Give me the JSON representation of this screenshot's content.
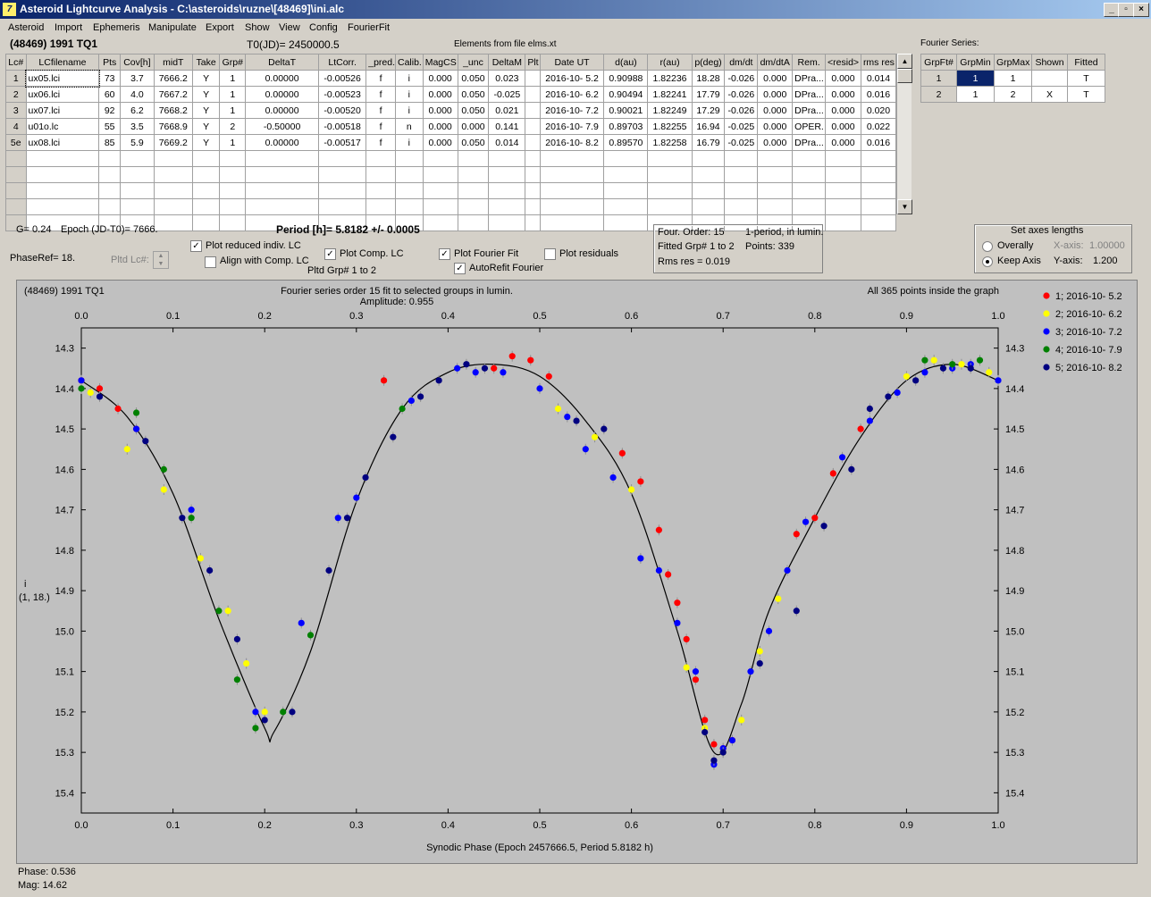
{
  "window": {
    "title": "Asteroid Lightcurve Analysis - C:\\asteroids\\ruzne\\[48469]\\ini.alc",
    "icon_glyph": "7"
  },
  "menu": [
    "Asteroid",
    "Import",
    "Ephemeris",
    "Manipulate",
    "Export",
    "Show",
    "View",
    "Config",
    "FourierFit"
  ],
  "header": {
    "asteroid": "(48469) 1991 TQ1",
    "t0": "T0(JD)= 2450000.5",
    "elements": "Elements from file elms.xt"
  },
  "lc_table": {
    "columns": [
      "Lc#",
      "LCfilename",
      "Pts",
      "Cov[h]",
      "midT",
      "Take",
      "Grp#",
      "DeltaT",
      "LtCorr.",
      "_pred.",
      "Calib.",
      "MagCS",
      "_unc",
      "DeltaM",
      "Plt",
      "Date UT",
      "d(au)",
      "r(au)",
      "p(deg)",
      "dm/dt",
      "dm/dtA",
      "Rem.",
      "<resid>",
      "rms res"
    ],
    "rows": [
      [
        "1",
        "ux05.lci",
        "73",
        "3.7",
        "7666.2",
        "Y",
        "1",
        "0.00000",
        "-0.00526",
        "f",
        "i",
        "0.000",
        "0.050",
        "0.023",
        "",
        "2016-10- 5.2",
        "0.90988",
        "1.82236",
        "18.28",
        "-0.026",
        "0.000",
        "DPra...",
        "0.000",
        "0.014"
      ],
      [
        "2",
        "ux06.lci",
        "60",
        "4.0",
        "7667.2",
        "Y",
        "1",
        "0.00000",
        "-0.00523",
        "f",
        "i",
        "0.000",
        "0.050",
        "-0.025",
        "",
        "2016-10- 6.2",
        "0.90494",
        "1.82241",
        "17.79",
        "-0.026",
        "0.000",
        "DPra...",
        "0.000",
        "0.016"
      ],
      [
        "3",
        "ux07.lci",
        "92",
        "6.2",
        "7668.2",
        "Y",
        "1",
        "0.00000",
        "-0.00520",
        "f",
        "i",
        "0.000",
        "0.050",
        "0.021",
        "",
        "2016-10- 7.2",
        "0.90021",
        "1.82249",
        "17.29",
        "-0.026",
        "0.000",
        "DPra...",
        "0.000",
        "0.020"
      ],
      [
        "4",
        "u01o.lc",
        "55",
        "3.5",
        "7668.9",
        "Y",
        "2",
        "-0.50000",
        "-0.00518",
        "f",
        "n",
        "0.000",
        "0.000",
        "0.141",
        "",
        "2016-10- 7.9",
        "0.89703",
        "1.82255",
        "16.94",
        "-0.025",
        "0.000",
        "OPER.",
        "0.000",
        "0.022"
      ],
      [
        "5e",
        "ux08.lci",
        "85",
        "5.9",
        "7669.2",
        "Y",
        "1",
        "0.00000",
        "-0.00517",
        "f",
        "i",
        "0.000",
        "0.050",
        "0.014",
        "",
        "2016-10- 8.2",
        "0.89570",
        "1.82258",
        "16.79",
        "-0.025",
        "0.000",
        "DPra...",
        "0.000",
        "0.016"
      ]
    ],
    "empty_rows": 5
  },
  "fourier_table": {
    "title": "Fourier Series:",
    "columns": [
      "GrpFt#",
      "GrpMin",
      "GrpMax",
      "Shown",
      "Fitted"
    ],
    "rows": [
      [
        "1",
        "1",
        "1",
        "",
        "T"
      ],
      [
        "2",
        "1",
        "2",
        "X",
        "T"
      ]
    ]
  },
  "controls": {
    "g": "G= 0.24",
    "epoch": "Epoch (JD-T0)= 7666.",
    "period": "Period [h]= 5.8182 +/- 0.0005",
    "phaseref": "PhaseRef= 18.",
    "pltd_lc": "Pltd Lc#:",
    "plot_reduced": "Plot reduced indiv. LC",
    "align_comp": "Align with Comp. LC",
    "plot_comp": "Plot Comp. LC",
    "pltd_grp": "Pltd Grp#  1   to   2",
    "plot_fourier": "Plot Fourier Fit",
    "autorefit": "AutoRefit Fourier",
    "plot_resid": "Plot residuals",
    "check_reduced": true,
    "check_align": false,
    "check_comp": true,
    "check_fourier": true,
    "check_autorefit": true,
    "check_resid": false
  },
  "info_box": {
    "order": "Four. Order: 15",
    "period_mode": "1-period, in lumin.",
    "fitted": "Fitted Grp# 1 to 2",
    "points": "Points: 339",
    "rms": "Rms res     = 0.019"
  },
  "axes_box": {
    "title": "Set axes lengths",
    "overally": "Overally",
    "keep_axis": "Keep Axis",
    "x_axis_label": "X-axis:",
    "x_axis_value": "1.00000",
    "y_axis_label": "Y-axis:",
    "y_axis_value": "1.200",
    "selected": "keep_axis"
  },
  "plot": {
    "asteroid": "(48469) 1991 TQ1",
    "header_center": "Fourier series order 15 fit to selected groups in lumin.",
    "amplitude": "Amplitude: 0.955",
    "header_right": "All 365 points inside the graph",
    "ylabel_line1": "i",
    "ylabel_line2": "(1, 18.)",
    "xlabel": "Synodic Phase (Epoch 2457666.5, Period 5.8182 h)"
  },
  "chart_data": {
    "type": "scatter",
    "xlim": [
      0.0,
      1.0
    ],
    "ylim": [
      15.45,
      14.25
    ],
    "x_ticks": [
      "0.0",
      "0.1",
      "0.2",
      "0.3",
      "0.4",
      "0.5",
      "0.6",
      "0.7",
      "0.8",
      "0.9",
      "1.0"
    ],
    "y_ticks": [
      "14.3",
      "14.4",
      "14.5",
      "14.6",
      "14.7",
      "14.8",
      "14.9",
      "15.0",
      "15.1",
      "15.2",
      "15.3",
      "15.4"
    ],
    "y_reversed": true,
    "grid": false,
    "fit_curve": {
      "color": "#000000",
      "x": [
        0.0,
        0.05,
        0.1,
        0.15,
        0.2,
        0.21,
        0.25,
        0.3,
        0.35,
        0.4,
        0.45,
        0.5,
        0.55,
        0.6,
        0.65,
        0.69,
        0.72,
        0.75,
        0.8,
        0.85,
        0.9,
        0.95,
        1.0
      ],
      "y": [
        14.38,
        14.47,
        14.66,
        14.97,
        15.24,
        15.25,
        15.05,
        14.68,
        14.45,
        14.36,
        14.34,
        14.37,
        14.48,
        14.66,
        15.0,
        15.3,
        15.18,
        14.95,
        14.72,
        14.52,
        14.38,
        14.34,
        14.38
      ]
    },
    "legend_position": "top-right",
    "series": [
      {
        "name": "1; 2016-10- 5.2",
        "color": "#ff0000",
        "x": [
          0.0,
          0.02,
          0.04,
          0.06,
          0.33,
          0.45,
          0.47,
          0.49,
          0.51,
          0.59,
          0.61,
          0.63,
          0.64,
          0.65,
          0.66,
          0.67,
          0.68,
          0.69,
          0.7,
          0.71,
          0.78,
          0.8,
          0.82,
          0.85
        ],
        "y": [
          14.38,
          14.4,
          14.45,
          14.5,
          14.38,
          14.35,
          14.32,
          14.33,
          14.37,
          14.56,
          14.63,
          14.75,
          14.86,
          14.93,
          15.02,
          15.12,
          15.22,
          15.28,
          15.29,
          15.27,
          14.76,
          14.72,
          14.61,
          14.5
        ]
      },
      {
        "name": "2; 2016-10- 6.2",
        "color": "#ffff00",
        "x": [
          0.01,
          0.05,
          0.09,
          0.13,
          0.16,
          0.18,
          0.2,
          0.52,
          0.56,
          0.6,
          0.66,
          0.68,
          0.7,
          0.72,
          0.74,
          0.76,
          0.9,
          0.93,
          0.96,
          0.99
        ],
        "y": [
          14.41,
          14.55,
          14.65,
          14.82,
          14.95,
          15.08,
          15.2,
          14.45,
          14.52,
          14.65,
          15.09,
          15.24,
          15.3,
          15.22,
          15.05,
          14.92,
          14.37,
          14.33,
          14.34,
          14.36
        ]
      },
      {
        "name": "3; 2016-10- 7.2",
        "color": "#0000ff",
        "x": [
          0.0,
          0.06,
          0.12,
          0.19,
          0.24,
          0.28,
          0.3,
          0.36,
          0.41,
          0.43,
          0.46,
          0.5,
          0.53,
          0.55,
          0.58,
          0.61,
          0.63,
          0.65,
          0.67,
          0.69,
          0.7,
          0.71,
          0.73,
          0.75,
          0.77,
          0.79,
          0.83,
          0.86,
          0.89,
          0.92,
          0.95,
          0.97,
          1.0
        ],
        "y": [
          14.38,
          14.5,
          14.7,
          15.2,
          14.98,
          14.72,
          14.67,
          14.43,
          14.35,
          14.36,
          14.36,
          14.4,
          14.47,
          14.55,
          14.62,
          14.82,
          14.85,
          14.98,
          15.1,
          15.33,
          15.29,
          15.27,
          15.1,
          15.0,
          14.85,
          14.73,
          14.57,
          14.48,
          14.41,
          14.36,
          14.35,
          14.34,
          14.38
        ]
      },
      {
        "name": "4; 2016-10- 7.9",
        "color": "#008000",
        "x": [
          0.0,
          0.06,
          0.09,
          0.12,
          0.15,
          0.17,
          0.19,
          0.22,
          0.25,
          0.35,
          0.92,
          0.95,
          0.98
        ],
        "y": [
          14.4,
          14.46,
          14.6,
          14.72,
          14.95,
          15.12,
          15.24,
          15.2,
          15.01,
          14.45,
          14.33,
          14.34,
          14.33
        ]
      },
      {
        "name": "5; 2016-10- 8.2",
        "color": "#000080",
        "x": [
          0.02,
          0.07,
          0.11,
          0.14,
          0.17,
          0.2,
          0.23,
          0.27,
          0.29,
          0.31,
          0.34,
          0.37,
          0.39,
          0.42,
          0.44,
          0.54,
          0.57,
          0.68,
          0.69,
          0.7,
          0.74,
          0.78,
          0.81,
          0.84,
          0.86,
          0.88,
          0.91,
          0.94,
          0.97
        ],
        "y": [
          14.42,
          14.53,
          14.72,
          14.85,
          15.02,
          15.22,
          15.2,
          14.85,
          14.72,
          14.62,
          14.52,
          14.42,
          14.38,
          14.34,
          14.35,
          14.48,
          14.5,
          15.25,
          15.32,
          15.3,
          15.08,
          14.95,
          14.74,
          14.6,
          14.45,
          14.42,
          14.38,
          14.35,
          14.35
        ]
      }
    ]
  },
  "status": {
    "phase": "Phase:  0.536",
    "mag": "Mag:    14.62"
  }
}
